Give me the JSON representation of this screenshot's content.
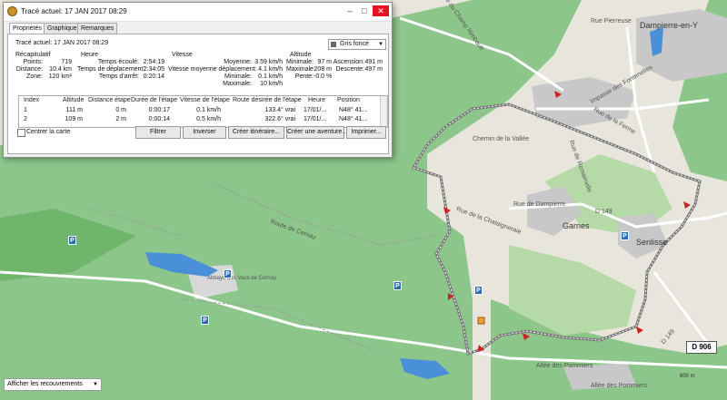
{
  "window": {
    "title": "Tracé actuel: 17 JAN 2017 08:29",
    "minimize": "–",
    "maximize": "□",
    "close": "✕"
  },
  "tabs": [
    "Propriétés",
    "Graphique",
    "Remarques"
  ],
  "track": {
    "label": "Tracé actuel: 17 JAN 2017 08:29",
    "color": "Gris foncé",
    "color_hex": "#666666"
  },
  "summary": {
    "title": "Récapitulatif",
    "points_label": "Points:",
    "points": "719",
    "distance_label": "Distance:",
    "distance": "10.4 km",
    "zone_label": "Zone:",
    "zone": "120 km²"
  },
  "time": {
    "title": "Heure",
    "elapsed_label": "Temps écoulé:",
    "elapsed": "2:54:19",
    "moving_label": "Temps de déplacement:",
    "moving": "2:34:05",
    "stopped_label": "Temps d'arrêt:",
    "stopped": "0:20:14"
  },
  "speed": {
    "title": "Vitesse",
    "avg_label": "Moyenne:",
    "avg": "3.59 km/h",
    "moving_avg_label": "Vitesse moyenne déplacement:",
    "moving_avg": "4.1 km/h",
    "min_label": "Minimale:",
    "min": "0.1 km/h",
    "max_label": "Maximale:",
    "max": "10 km/h"
  },
  "altitude": {
    "title": "Altitude",
    "min_label": "Minimale:",
    "min": "97 m",
    "max_label": "Maximale:",
    "max": "208 m",
    "slope_label": "Pente:",
    "slope": "-0.0 %",
    "ascent_label": "Ascension:",
    "ascent": "491 m",
    "descent_label": "Descente:",
    "descent": "497 m"
  },
  "table": {
    "headers": [
      "Index",
      "Altitude",
      "Distance étape",
      "Durée de l'étape",
      "Vitesse de l'étape",
      "Route désirée de l'étape",
      "Heure",
      "Position"
    ],
    "rows": [
      [
        "1",
        "111 m",
        "0 m",
        "0:00:17",
        "0.1 km/h",
        "133.4° vrai",
        "17/01/...",
        "N48° 41..."
      ],
      [
        "2",
        "109 m",
        "2 m",
        "0:00:14",
        "0.5 km/h",
        "322.6° vrai",
        "17/01/...",
        "N48° 41..."
      ]
    ]
  },
  "buttons": {
    "center": "Centrer la carte",
    "filter": "Filtrer",
    "reverse": "Inverser",
    "create_route": "Créer itinéraire...",
    "create_adventure": "Créer une aventure...",
    "print": "Imprimer..."
  },
  "map": {
    "overlay_dropdown": "Afficher les recouvrements",
    "road_number": "D 906",
    "scale": "800 m",
    "places": [
      "Dampierre-en-Y",
      "Garnes",
      "Senlisse",
      "Allée des Pommiers",
      "Abbaye des Vaux de Cernay"
    ],
    "streets": [
      "Rue du Champ Rimbault",
      "Rue Pierreuse",
      "Impasse des Fontenelles",
      "Rue de la Ferme",
      "Rue de Dampierre",
      "Rue de la Chataigneraie",
      "Rue de Romainville",
      "Route de Cernay",
      "Allée des Pommiers",
      "Chemin de la Vallée",
      "D 149",
      "D 149"
    ],
    "colors": {
      "forest": "#8dc68a",
      "field": "#e8e6dc",
      "water": "#4a90d9",
      "track": "#8a8a8a",
      "urban": "#c8c8c8",
      "marker": "#cc2222"
    }
  }
}
